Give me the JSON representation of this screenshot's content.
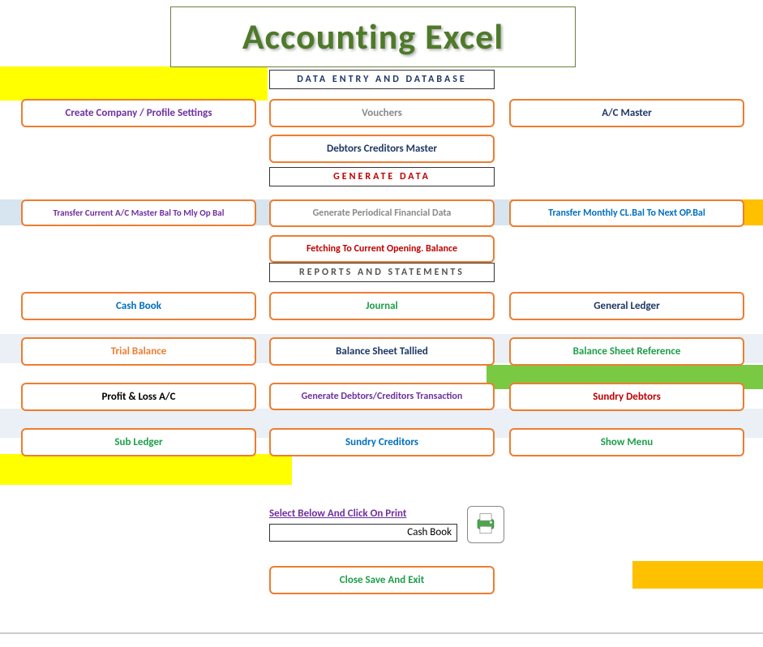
{
  "title": "Accounting Excel",
  "sections": {
    "data_entry": "DATA ENTRY AND DATABASE",
    "generate": "GENERATE  DATA",
    "reports": "REPORTS  AND  STATEMENTS"
  },
  "buttons": {
    "create_company": "Create Company / Profile Settings",
    "vouchers": "Vouchers",
    "ac_master": "A/C  Master",
    "debtors_creditors": "Debtors Creditors Master",
    "transfer_current": "Transfer Current  A/C Master  Bal  To Mly Op Bal",
    "gen_periodical": "Generate Periodical Financial Data",
    "transfer_monthly": "Transfer Monthly  CL.Bal To Next OP.Bal",
    "fetching": "Fetching  To Current Opening. Balance",
    "cash_book": "Cash Book",
    "journal": "Journal",
    "general_ledger": "General Ledger",
    "trial_balance": "Trial Balance",
    "balance_sheet": "Balance Sheet Tallied",
    "balance_ref": "Balance Sheet Reference",
    "profit_loss": "Profit & Loss A/C",
    "gen_debtors": "Generate Debtors/Creditors Transaction",
    "sundry_debtors": "Sundry Debtors",
    "sub_ledger": "Sub Ledger",
    "sundry_creditors": "Sundry Creditors",
    "show_menu": "Show Menu",
    "close_save": "Close Save And Exit"
  },
  "print": {
    "label": "Select Below And Click On Print",
    "selected": "Cash Book"
  }
}
